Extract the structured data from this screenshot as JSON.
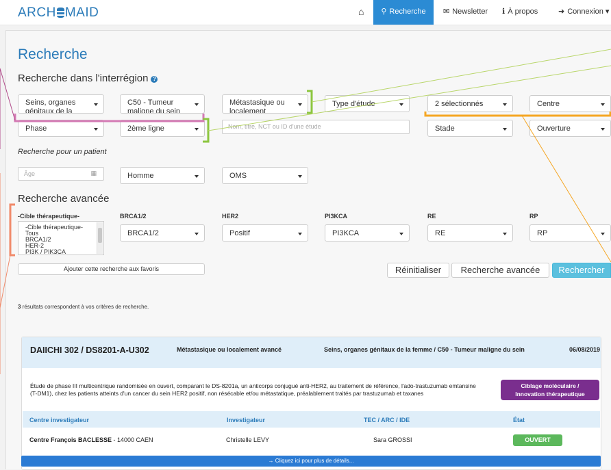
{
  "nav": {
    "logo_left": "ARCH",
    "logo_right": "MAID",
    "items": [
      {
        "label": "Recherche",
        "icon": "search-icon",
        "glyph": "🔍"
      },
      {
        "label": "Newsletter",
        "icon": "envelope-icon",
        "glyph": "✉"
      },
      {
        "label": "À propos",
        "icon": "info-icon",
        "glyph": "ℹ"
      },
      {
        "label": "Connexion",
        "icon": "login-icon",
        "glyph": "➜"
      }
    ],
    "home_glyph": "⌂"
  },
  "page": {
    "title": "Recherche",
    "subtitle": "Recherche dans l'interrégion",
    "help_glyph": "?"
  },
  "filters_row1": [
    "Seins, organes génitaux de la",
    "C50 - Tumeur maligne du sein",
    "Métastasique ou localement",
    "Type d'étude",
    "2 sélectionnés",
    "Centre"
  ],
  "filters_row2": {
    "phase": "Phase",
    "ligne": "2ème ligne",
    "search_placeholder": "Nom, titre, NCT ou ID d'une étude",
    "stade": "Stade",
    "ouverture": "Ouverture"
  },
  "patient": {
    "label": "Recherche pour un patient",
    "age_placeholder": "Âge",
    "sexe": "Homme",
    "oms": "OMS"
  },
  "advanced": {
    "label": "Recherche avancée",
    "columns": [
      "-Cible thérapeutique-",
      "BRCA1/2",
      "HER2",
      "PI3KCA",
      "RE",
      "RP"
    ],
    "list_options": [
      "-Cible thérapeutique-",
      "Tous",
      "BRCA1/2",
      "HER-2",
      "PI3K / PIK3CA"
    ],
    "values": [
      "BRCA1/2",
      "Positif",
      "PI3KCA",
      "RE",
      "RP"
    ]
  },
  "buttons": {
    "favoris": "Ajouter cette recherche aux favoris",
    "reset": "Réinitialiser",
    "advanced": "Recherche avancée",
    "search": "Rechercher"
  },
  "results": {
    "count": "3",
    "text": " résultats correspondent à vos critères de recherche."
  },
  "study": {
    "title": "DAIICHI 302 / DS8201-A-U302",
    "stage": "Métastasique ou localement avancé",
    "organ": "Seins, organes génitaux de la femme / C50 - Tumeur maligne du sein",
    "date": "06/08/2019",
    "description": "Étude de phase III multicentrique randomisée en ouvert, comparant le DS-8201a, un anticorps conjugué anti-HER2, au traitement de référence, l'ado-trastuzumab emtansine (T-DM1), chez les patients atteints d'un cancer du sein HER2 positif, non résécable et/ou métastatique, préalablement traités par trastuzumab et taxanes",
    "tag_line1": "Ciblage moléculaire /",
    "tag_line2": "Innovation thérapeutique",
    "table_headers": [
      "Centre investigateur",
      "Investigateur",
      "TEC / ARC / IDE",
      "État"
    ],
    "centre_name": "Centre François BACLESSE",
    "centre_city": " - 14000 CAEN",
    "investigator": "Christelle LEVY",
    "tec": "Sara GROSSI",
    "state": "OUVERT",
    "more": "→ Cliquez ici pour plus de détails..."
  },
  "colors": {
    "accent": "#2b7bb9",
    "nav_active": "#2b8bd4",
    "pink": "#d47ab4",
    "green": "#8cc63f",
    "orange": "#f5a623",
    "salmon": "#f08a6a",
    "tag": "#7a2e8e",
    "open": "#5cb85c"
  }
}
